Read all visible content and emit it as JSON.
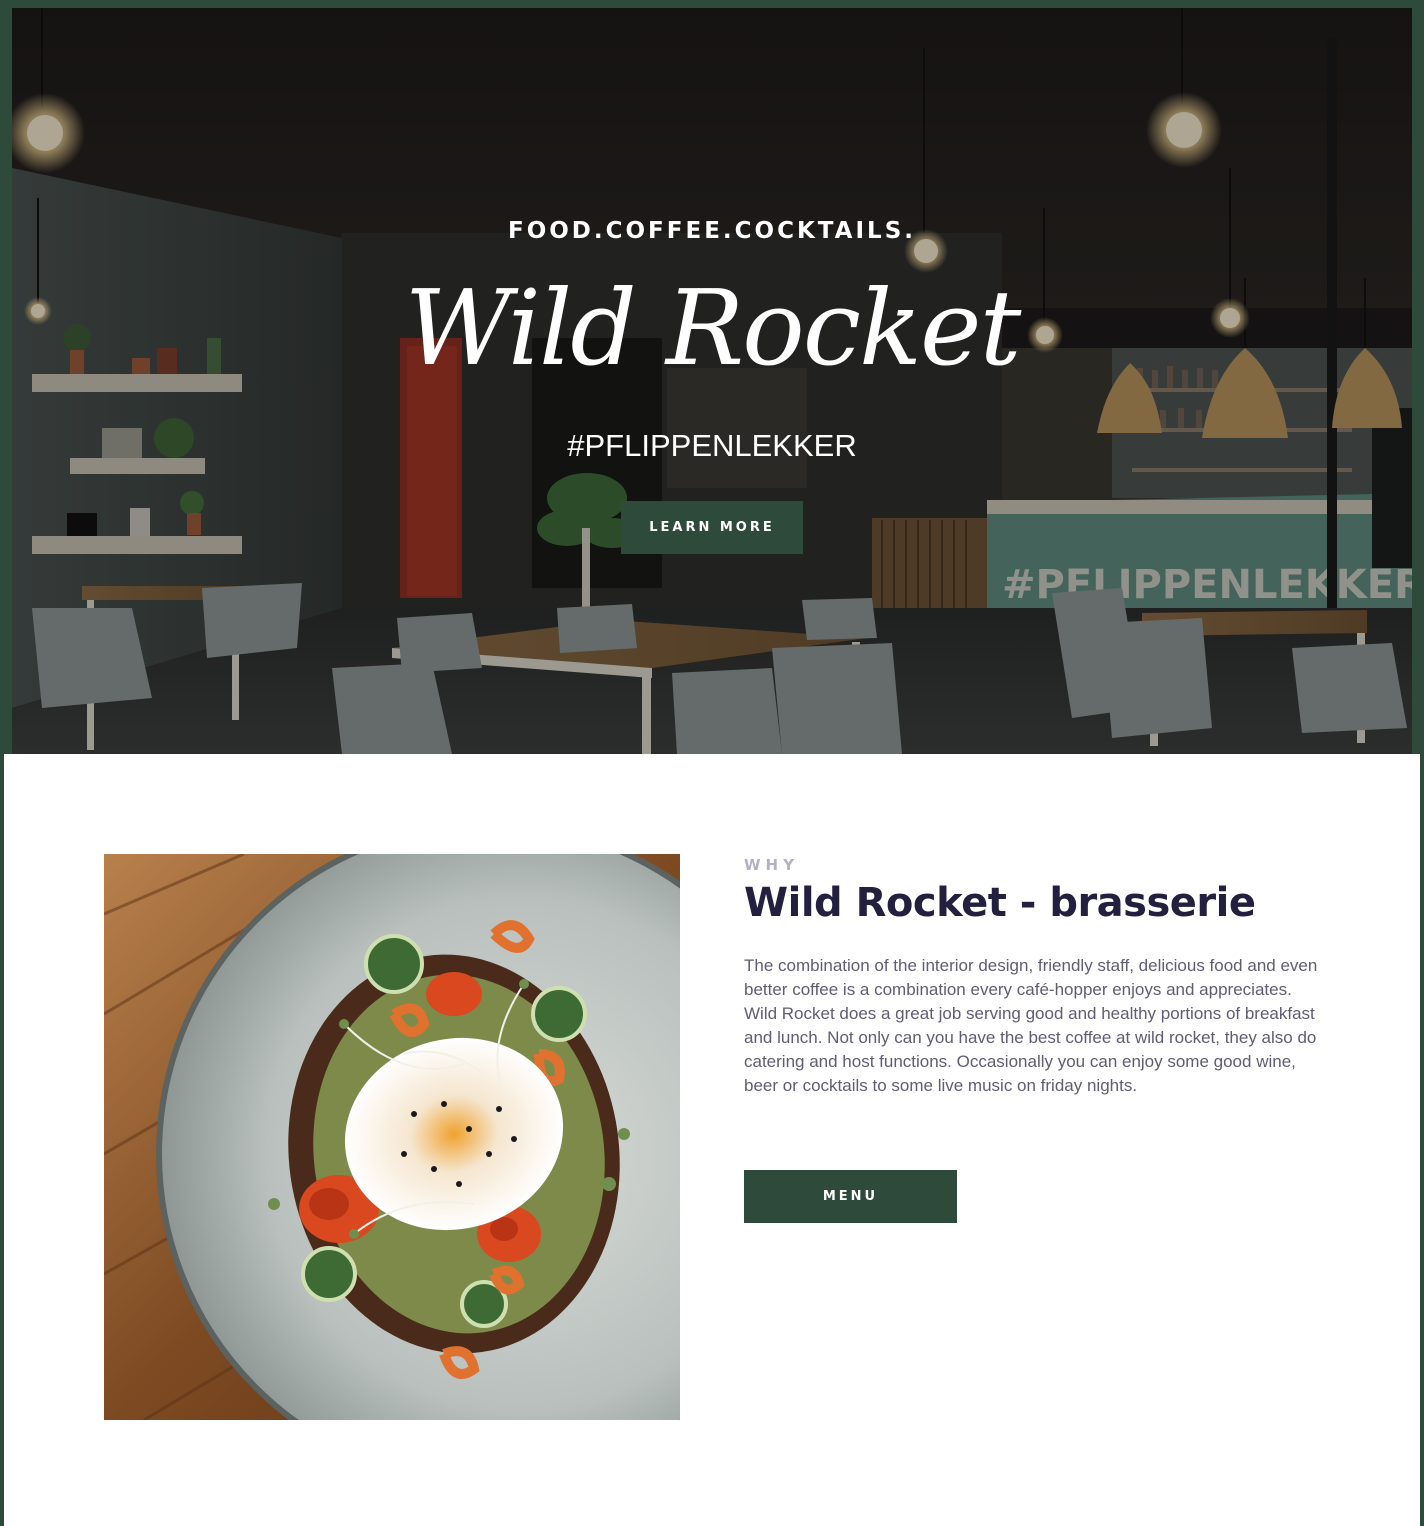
{
  "hero": {
    "tagline": "FOOD.COFFEE.COCKTAILS.",
    "logo_text": "Wild Rocket",
    "hashtag": "#PFLIPPENLEKKER",
    "cta_label": "LEARN MORE",
    "wall_sign": "#PFLIPPENLEKKER"
  },
  "about": {
    "eyebrow": "WHY",
    "title": "Wild Rocket - brasserie",
    "body": "The combination of the interior design, friendly staff, delicious food and even better coffee is a combination every café-hopper enjoys and appreciates. Wild Rocket does a great job serving good and healthy portions of breakfast and lunch. Not only can you have the best coffee at wild rocket, they also do catering and host functions. Occasionally you can enjoy some good wine, beer or cocktails to some live music on friday nights.",
    "menu_label": "MENU"
  },
  "colors": {
    "brand_green": "#2e4a3b",
    "heading_navy": "#221f3f",
    "eyebrow_gray": "#b3b1c3",
    "body_text": "#5f5d73"
  }
}
